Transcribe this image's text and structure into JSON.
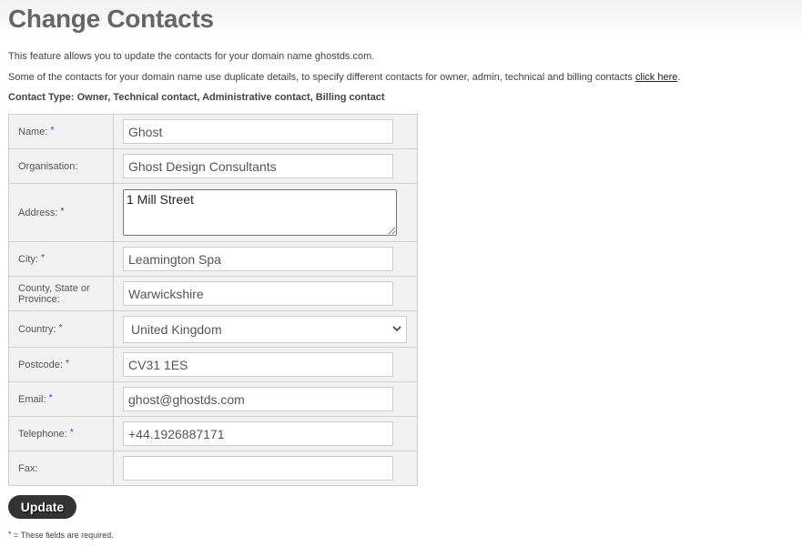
{
  "page": {
    "title": "Change Contacts",
    "intro_line1": "This feature allows you to update the contacts for your domain name ghostds.com.",
    "intro_line2_prefix": "Some of the contacts for your domain name use duplicate details, to specify different contacts for owner, admin, technical and billing contacts ",
    "intro_line2_link": "click here",
    "intro_line2_suffix": ".",
    "contact_type": "Contact Type: Owner, Technical contact, Administrative contact, Billing contact"
  },
  "form": {
    "required_marker": "*",
    "fields": {
      "name": {
        "label": "Name:",
        "value": "Ghost",
        "required": true
      },
      "organisation": {
        "label": "Organisation:",
        "value": "Ghost Design Consultants",
        "required": false
      },
      "address": {
        "label": "Address:",
        "value": "1 Mill Street",
        "required": true
      },
      "city": {
        "label": "City:",
        "value": "Leamington Spa",
        "required": true
      },
      "county": {
        "label": "County, State or Province:",
        "value": "Warwickshire",
        "required": false
      },
      "country": {
        "label": "Country:",
        "value": "United Kingdom",
        "required": true
      },
      "postcode": {
        "label": "Postcode:",
        "value": "CV31 1ES",
        "required": true
      },
      "email": {
        "label": "Email:",
        "value": "ghost@ghostds.com",
        "required": true
      },
      "telephone": {
        "label": "Telephone:",
        "value": "+44.1926887171",
        "required": true
      },
      "fax": {
        "label": "Fax:",
        "value": "",
        "required": false
      }
    },
    "submit_label": "Update",
    "footnote_marker": "*",
    "footnote_text": " = These fields are required."
  },
  "icons": {
    "select_arrow": "chevron-down-icon",
    "textarea_resize": "resize-handle-icon"
  },
  "colors": {
    "required_marker": "#1a3fd6",
    "button_bg": "#333333",
    "label_cell_bg": "#f2f2f2"
  }
}
